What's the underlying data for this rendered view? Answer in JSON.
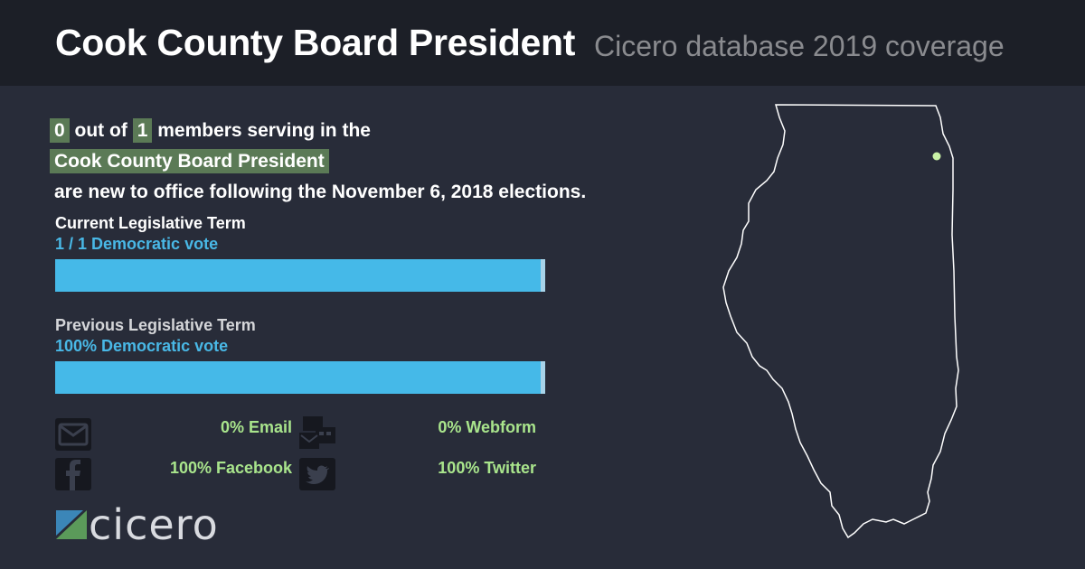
{
  "header": {
    "title": "Cook County Board President",
    "subtitle": "Cicero database 2019 coverage"
  },
  "summary": {
    "new_count": "0",
    "out_of_text": "out of",
    "total_count": "1",
    "members_text": "members serving in the",
    "office": "Cook County Board President",
    "closing_text": "are new to office following the November 6, 2018 elections."
  },
  "current_term": {
    "label": "Current Legislative Term",
    "vote_text": "1 / 1 Democratic vote",
    "democratic_fraction": 0.99
  },
  "previous_term": {
    "label": "Previous Legislative Term",
    "vote_text": "100% Democratic vote",
    "democratic_fraction": 0.99
  },
  "contact_stats": [
    {
      "icon": "email-icon",
      "text": "0% Email"
    },
    {
      "icon": "webform-icon",
      "text": "0% Webform"
    },
    {
      "icon": "facebook-icon",
      "text": "100% Facebook"
    },
    {
      "icon": "twitter-icon",
      "text": "100% Twitter"
    }
  ],
  "logo": {
    "text": "cicero"
  },
  "map": {
    "state": "Illinois",
    "marker": "Cook County"
  },
  "colors": {
    "background": "#282c39",
    "header": "#1c1f27",
    "highlight": "#5b7a56",
    "democratic_blue": "#45b9e8",
    "stat_green": "#a9e58c",
    "marker": "#c9f2a6"
  }
}
